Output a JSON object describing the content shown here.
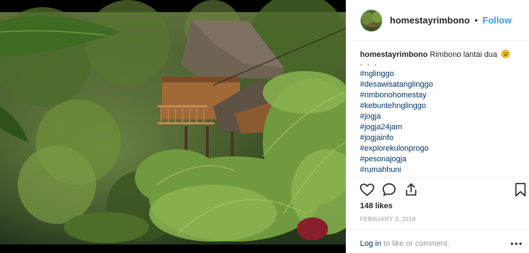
{
  "post": {
    "image_alt": "Wooden stilt house among lush tropical ferns and forest",
    "icon": "photo-content"
  },
  "header": {
    "username": "homestayrimbono",
    "separator": "•",
    "follow_label": "Follow"
  },
  "caption": {
    "username": "homestayrimbono",
    "text": "Rimbono lantai dua",
    "emoji": "grinning-face-emoji",
    "dots": ". . .",
    "hashtags": [
      "#nglinggo",
      "#desawisatanglinggo",
      "#rimbonohomestay",
      "#kebuntehnglinggo",
      "#jogja",
      "#jogja24jam",
      "#jogjainfo",
      "#explorekulonprogo",
      "#pesonajogja",
      "#rumahhuni"
    ]
  },
  "actions": {
    "like_icon": "heart-icon",
    "comment_icon": "comment-icon",
    "share_icon": "share-icon",
    "save_icon": "bookmark-icon"
  },
  "likes_text": "148 likes",
  "date_text": "FEBRUARY 3, 2018",
  "footer": {
    "login_link": "Log in",
    "rest_text": " to like or comment.",
    "more_icon": "more-options-icon"
  },
  "colors": {
    "link_blue": "#3897f0",
    "hashtag_blue": "#003569",
    "muted_gray": "#999999"
  }
}
